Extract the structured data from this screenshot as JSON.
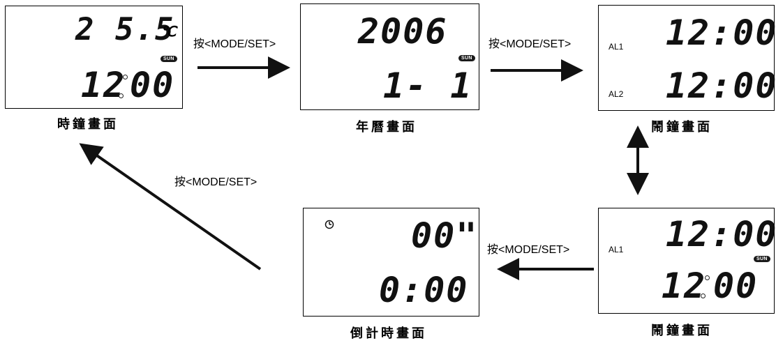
{
  "screens": {
    "clock": {
      "caption": "時鐘畫面",
      "temp": "2 5.5",
      "temp_unit": "℃",
      "day_badge": "SUN",
      "hour": "12",
      "minute": "00"
    },
    "calendar": {
      "caption": "年曆畫面",
      "year": "2006",
      "day_badge": "SUN",
      "month_day": "1- 1"
    },
    "alarm_a": {
      "caption": "鬧鐘畫面",
      "al1_label": "AL1",
      "al1_time": "12:00",
      "al2_label": "AL2",
      "al2_time": "12:00"
    },
    "alarm_b": {
      "caption": "鬧鐘畫面",
      "al1_label": "AL1",
      "al1_time": "12:00",
      "day_badge": "SUN",
      "hour": "12",
      "minute": "00"
    },
    "countdown": {
      "caption": "倒計時畫面",
      "timer_icon": "timer-icon",
      "seconds": "00\"",
      "time": "0:00"
    }
  },
  "transitions": {
    "clock_to_calendar": "按<MODE/SET>",
    "calendar_to_alarm": "按<MODE/SET>",
    "alarm_to_countdown": "按<MODE/SET>",
    "countdown_to_clock": "按<MODE/SET>"
  }
}
